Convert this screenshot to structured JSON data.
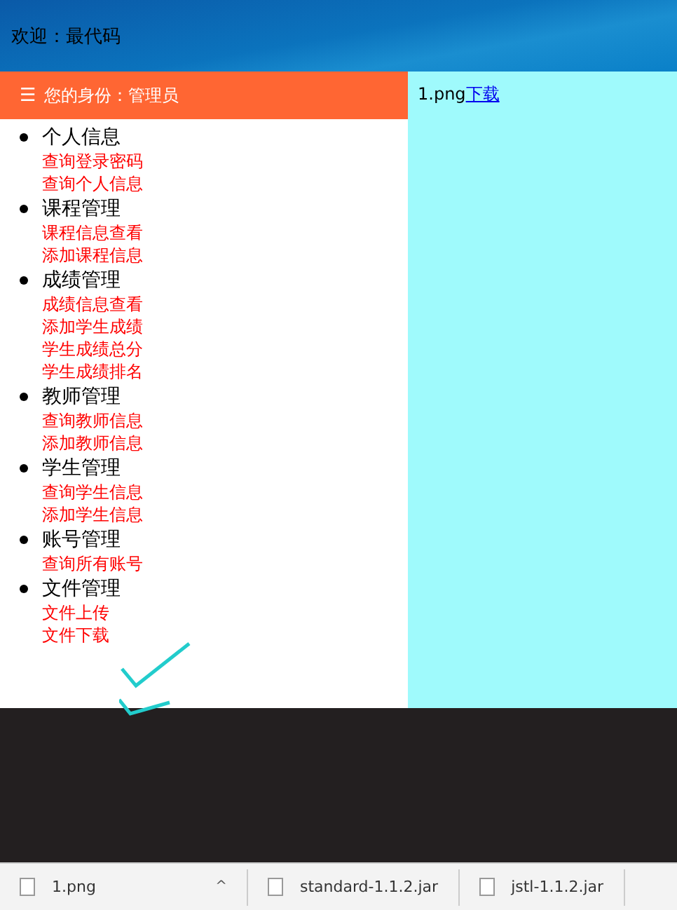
{
  "header": {
    "welcome": "欢迎：最代码"
  },
  "sidebar": {
    "title": "您的身份：管理员",
    "menu_icon": "☰",
    "groups": [
      {
        "label": "个人信息",
        "items": [
          "查询登录密码",
          "查询个人信息"
        ]
      },
      {
        "label": "课程管理",
        "items": [
          "课程信息查看",
          "添加课程信息"
        ]
      },
      {
        "label": "成绩管理",
        "items": [
          "成绩信息查看",
          "添加学生成绩",
          "学生成绩总分",
          "学生成绩排名"
        ]
      },
      {
        "label": "教师管理",
        "items": [
          "查询教师信息",
          "添加教师信息"
        ]
      },
      {
        "label": "学生管理",
        "items": [
          "查询学生信息",
          "添加学生信息"
        ]
      },
      {
        "label": "账号管理",
        "items": [
          "查询所有账号"
        ]
      },
      {
        "label": "文件管理",
        "items": [
          "文件上传",
          "文件下载"
        ]
      }
    ]
  },
  "content": {
    "file_name": "1.png",
    "link": "下载"
  },
  "downloads": [
    {
      "name": "1.png",
      "caret": "^"
    },
    {
      "name": "standard-1.1.2.jar"
    },
    {
      "name": "jstl-1.1.2.jar"
    }
  ]
}
